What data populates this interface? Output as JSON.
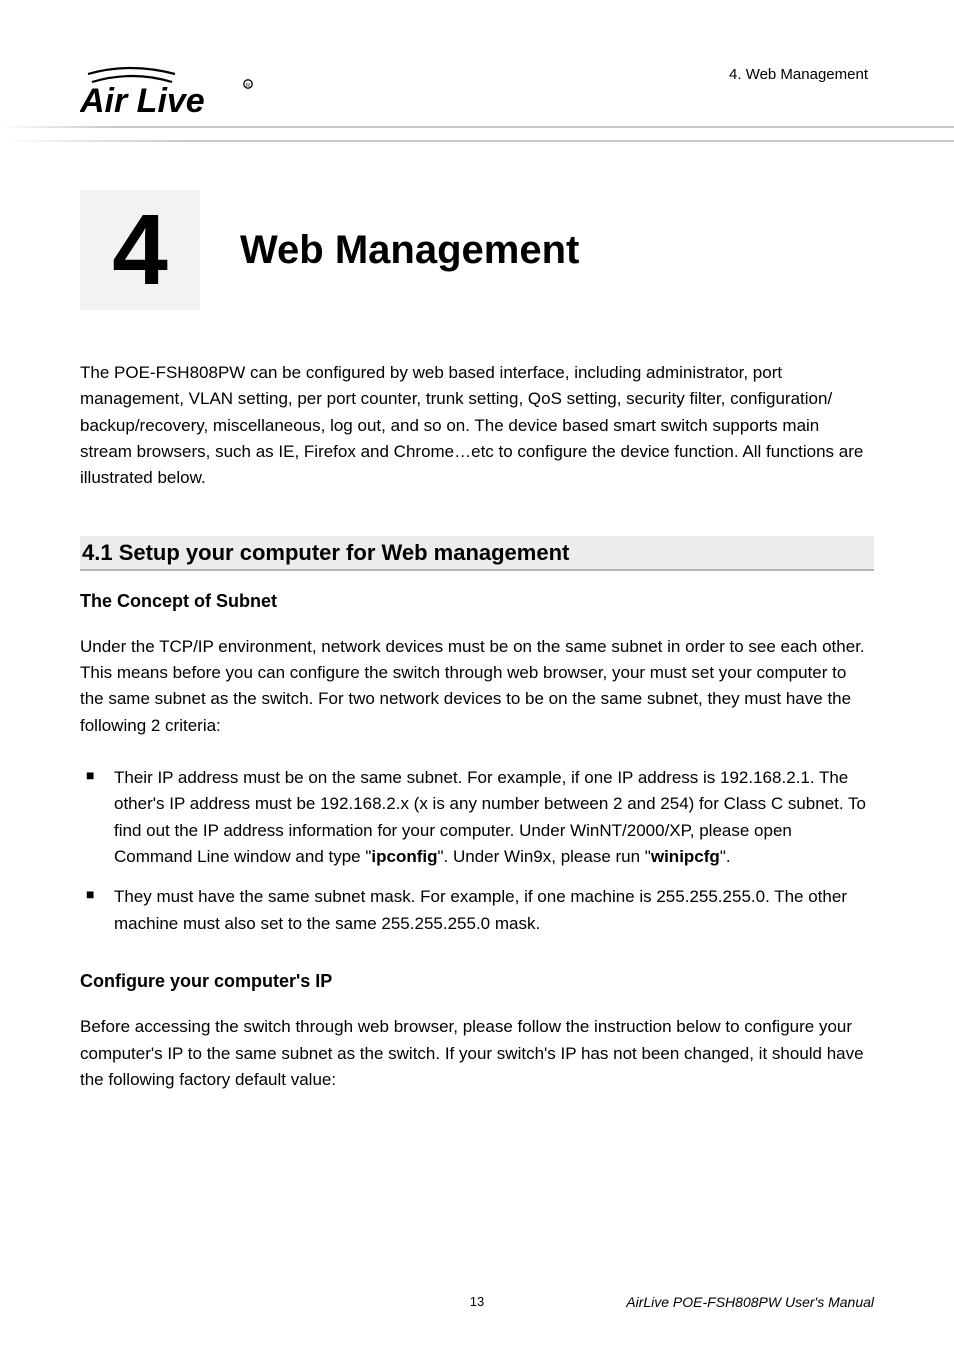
{
  "header": {
    "logo_text": "Air Live",
    "breadcrumb": "4. Web Management"
  },
  "chapter": {
    "number": "4",
    "title": "Web Management"
  },
  "intro": "The POE-FSH808PW can be configured by web based interface, including administrator, port management, VLAN setting, per port counter, trunk setting, QoS setting, security filter, configuration/ backup/recovery, miscellaneous, log out, and so on. The device based smart switch supports main stream browsers, such as IE, Firefox and Chrome…etc to configure the device function. All functions are illustrated below.",
  "section": {
    "heading": "4.1 Setup your computer for Web management",
    "sub1": {
      "title": "The Concept of Subnet",
      "para": "Under the TCP/IP environment, network devices must be on the same subnet in order to see each other. This means before you can configure the switch through web browser, your must set your computer to the same subnet as the switch. For two network devices to be on the same subnet, they must have the following 2 criteria:",
      "bullet1_pre": "Their IP address must be on the same subnet. For example, if one IP address is 192.168.2.1. The other's IP address must be 192.168.2.x (x is any number between 2 and 254) for Class C subnet. To find out the IP address information for your computer. Under WinNT/2000/XP, please open Command Line window and type \"",
      "bullet1_cmd1": "ipconfig",
      "bullet1_mid": "\". Under Win9x, please run \"",
      "bullet1_cmd2": "winipcfg",
      "bullet1_post": "\".",
      "bullet2": "They must have the same subnet mask. For example, if one machine is 255.255.255.0. The other machine must also set to the same 255.255.255.0 mask."
    },
    "sub2": {
      "title": "Configure your computer's IP",
      "para": "Before accessing the switch through web browser, please follow the instruction below to configure your computer's IP to the same subnet as the switch. If your switch's IP has not been changed, it should have the following factory default value:"
    }
  },
  "footer": {
    "page": "13",
    "manual": "AirLive POE-FSH808PW User's Manual"
  }
}
